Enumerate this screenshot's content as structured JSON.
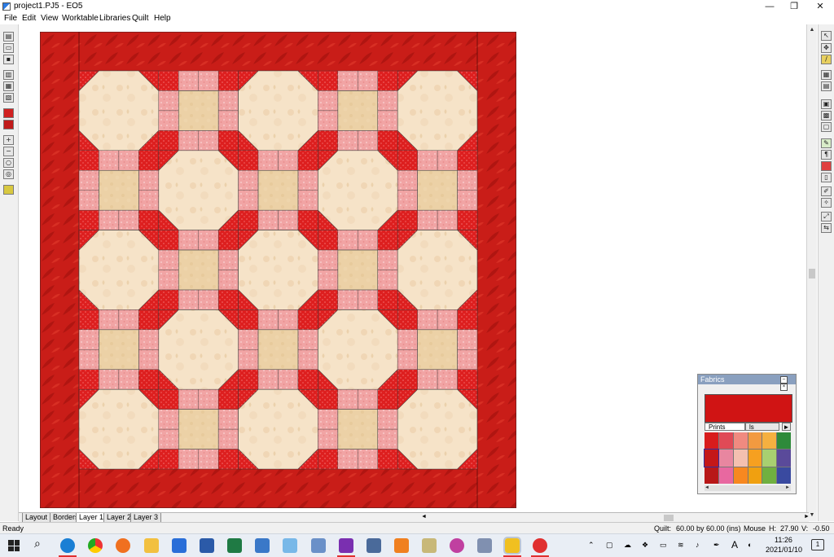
{
  "window": {
    "title": "project1.PJ5 - EO5",
    "minimize": "—",
    "maximize": "❐",
    "close": "✕"
  },
  "menu": [
    "File",
    "Edit",
    "View",
    "Worktable",
    "Libraries",
    "Quilt",
    "Help"
  ],
  "layer_tabs": [
    "Layout",
    "Borders",
    "Layer 1",
    "Layer 2",
    "Layer 3"
  ],
  "active_tab": "Layer 1",
  "status": {
    "ready": "Ready",
    "quilt_label": "Quilt:",
    "quilt_size": "60.00 by 60.00 (ins)",
    "mouse_label": "Mouse",
    "h_label": "H:",
    "h_value": "27.90",
    "v_label": "V:",
    "v_value": "-0.50"
  },
  "fabrics_palette": {
    "title": "Fabrics",
    "tab_prints": "Prints",
    "tab_other": "ls",
    "swatches": [
      "#d81c1c",
      "#e04a56",
      "#f08a80",
      "#f29a40",
      "#f5b040",
      "#2e8a3a",
      "#c41818",
      "#e886a0",
      "#f4c0b0",
      "#f6a020",
      "#a8d070",
      "#5a4a9a",
      "#b81818",
      "#e868a0",
      "#f78820",
      "#f0a010",
      "#70b040",
      "#3a4aa0"
    ]
  },
  "colors": {
    "border_red": "#c91d18",
    "inner_red": "#dd1f1f",
    "octagon": "#f6e3c8",
    "pink": "#f1a4a4",
    "tan": "#ecd1a6"
  },
  "taskbar": {
    "time": "11:26",
    "date": "2021/01/10",
    "notification_count": "1",
    "input_indicator": "A"
  }
}
